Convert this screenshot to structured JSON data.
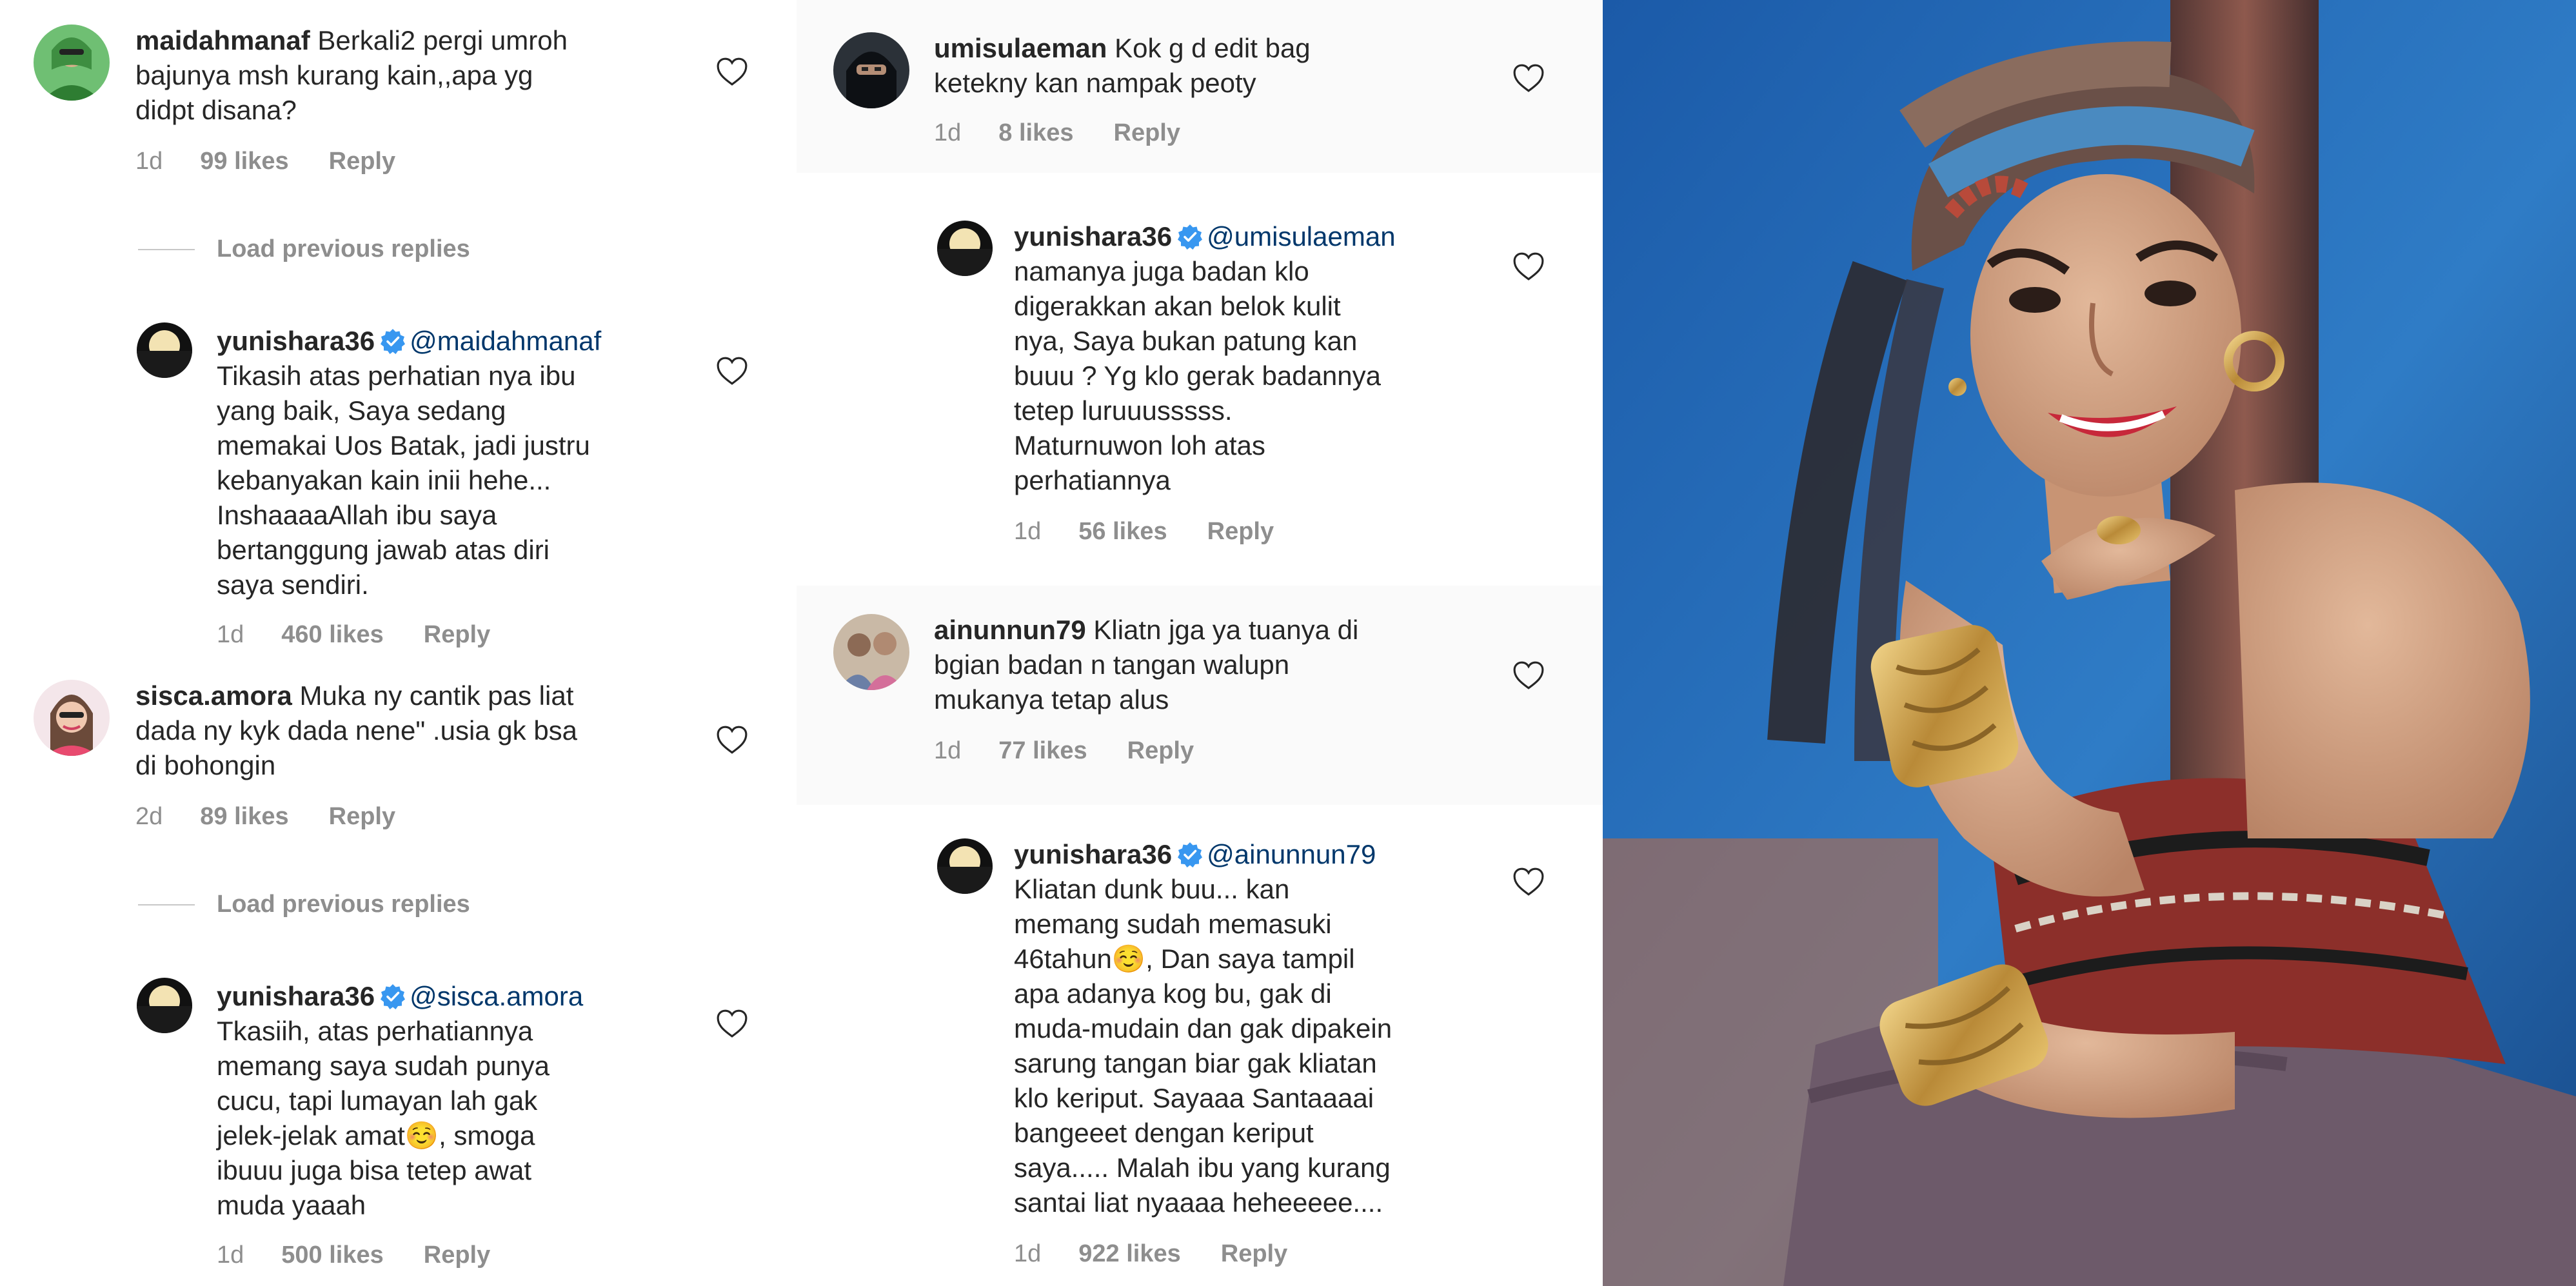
{
  "ui": {
    "reply_label": "Reply",
    "load_previous_label": "Load previous replies"
  },
  "left_panel": {
    "comments": [
      {
        "username": "maidahmanaf",
        "text": "Berkali2 pergi umroh\nbajunya msh kurang kain,,apa yg\ndidpt disana?",
        "age": "1d",
        "likes": "99 likes"
      },
      {
        "username": "yunishara36",
        "mention": "@maidahmanaf",
        "text": "Tikasih atas perhatian nya ibu\nyang baik,  Saya sedang\nmemakai Uos Batak, jadi justru\nkebanyakan kain inii hehe...\nInshaaaaAllah ibu saya\nbertanggung jawab atas diri\nsaya sendiri.",
        "age": "1d",
        "likes": "460 likes"
      },
      {
        "username": "sisca.amora",
        "text": "Muka ny cantik pas liat\ndada ny kyk dada nene\" .usia gk bsa\ndi bohongin",
        "age": "2d",
        "likes": "89 likes"
      },
      {
        "username": "yunishara36",
        "mention": "@sisca.amora",
        "text": "Tkasiih, atas perhatiannya\nmemang saya sudah punya\ncucu, tapi lumayan lah gak\njelek-jelak amat☺️, smoga\nibuuu juga bisa tetep awat\nmuda yaaah",
        "age": "1d",
        "likes": "500 likes"
      }
    ]
  },
  "mid_panel": {
    "comments": [
      {
        "username": "umisulaeman",
        "text": "Kok g d edit bag\nketekny kan nampak peoty",
        "age": "1d",
        "likes": "8 likes"
      },
      {
        "username": "yunishara36",
        "mention": "@umisulaeman",
        "text": "namanya juga badan klo\ndigerakkan akan belok kulit\nnya, Saya bukan patung kan\nbuuu ? Yg klo gerak badannya\ntetep luruuusssss.\nMaturnuwon loh atas\nperhatiannya",
        "age": "1d",
        "likes": "56 likes"
      },
      {
        "username": "ainunnun79",
        "text": "Kliatn jga ya tuanya di\nbgian badan n tangan walupn\nmukanya tetap alus",
        "age": "1d",
        "likes": "77 likes"
      },
      {
        "username": "yunishara36",
        "mention": "@ainunnun79",
        "text": "Kliatan dunk buu... kan\nmemang sudah memasuki\n46tahun☺️, Dan saya tampil\napa adanya kog bu, gak di\nmuda-mudain dan gak dipakein\nsarung tangan biar gak kliatan\nklo keriput.  Sayaaa Santaaaai\nbangeeet dengan keriput\nsaya..... Malah ibu yang kurang\nsantai liat nyaaaa heheeeee....",
        "age": "1d",
        "likes": "922 likes"
      }
    ]
  },
  "colors": {
    "text": "#262626",
    "meta": "#8e8e8e",
    "mention": "#00376b",
    "verified": "#3897f0",
    "photo_background": "#1d5fa5"
  },
  "icons": {
    "like": "heart-outline-icon",
    "verified": "verified-badge-icon"
  }
}
